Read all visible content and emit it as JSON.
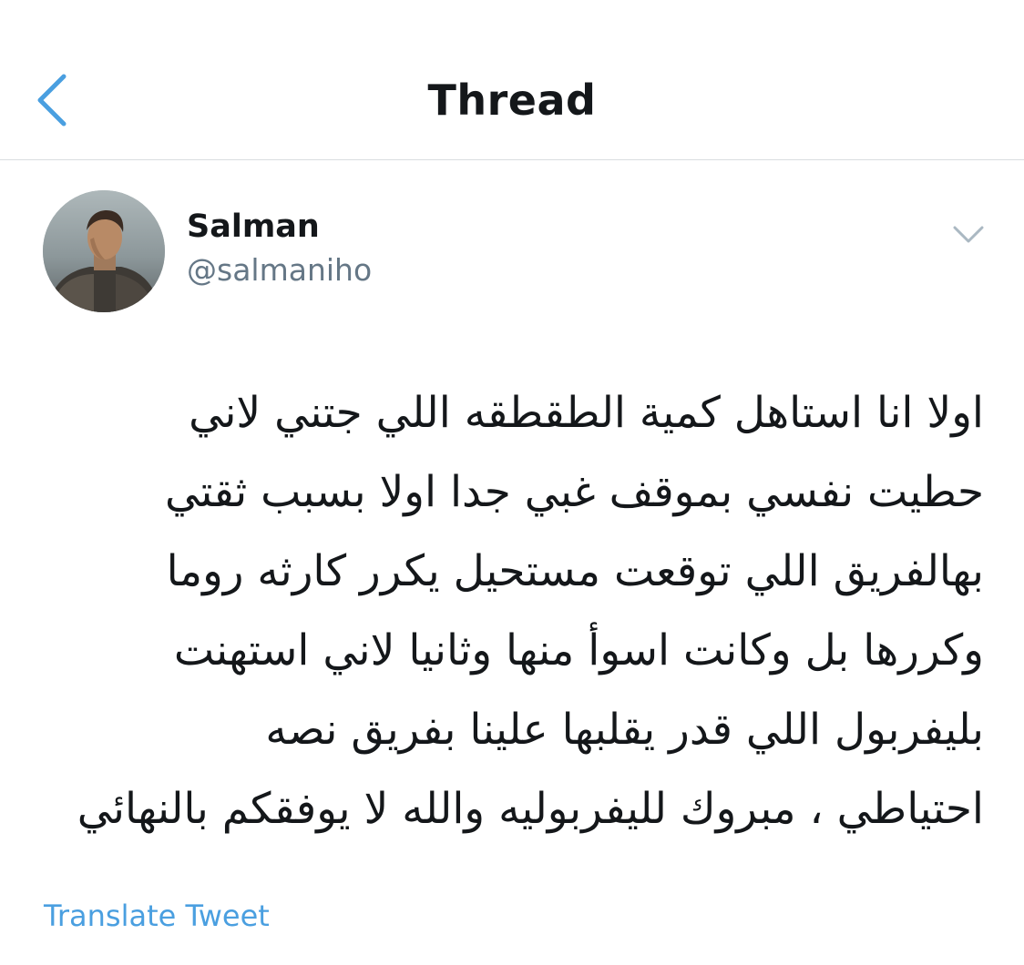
{
  "header": {
    "title": "Thread",
    "back_icon": "chevron-left-icon"
  },
  "tweet": {
    "author": {
      "display_name": "Salman",
      "handle": "@salmaniho",
      "avatar": "user-avatar"
    },
    "more_icon": "chevron-down-icon",
    "text_lines": [
      "اولا انا استاهل كمية الطقطقه اللي جتني لاني",
      "حطيت نفسي بموقف غبي جدا اولا بسبب ثقتي",
      "بهالفريق اللي توقعت مستحيل يكرر كارثه روما",
      "وكررها بل وكانت اسوأ منها وثانيا لاني استهنت",
      "بليفربول اللي قدر يقلبها علينا بفريق نصه",
      "احتياطي ، مبروك لليفربوليه والله لا يوفقكم بالنهائي"
    ],
    "translate_label": "Translate Tweet"
  },
  "colors": {
    "accent": "#4a9fe0",
    "text": "#14171a",
    "secondary_text": "#657786",
    "divider": "#d9dde0",
    "chevron": "#aab8c2"
  }
}
